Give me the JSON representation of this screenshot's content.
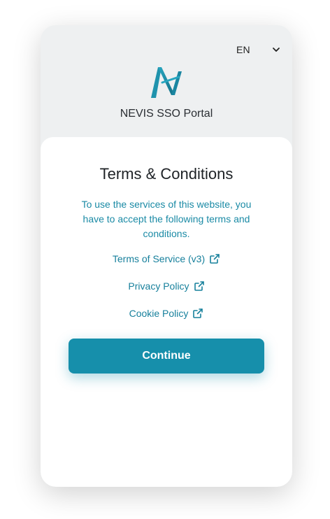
{
  "header": {
    "language": "EN",
    "portal_title": "NEVIS SSO Portal"
  },
  "terms": {
    "heading": "Terms & Conditions",
    "intro": "To use the services of this website, you have to accept the following terms and conditions.",
    "links": [
      {
        "label": "Terms of Service (v3)",
        "icon": "external-link-icon"
      },
      {
        "label": "Privacy Policy",
        "icon": "external-link-icon"
      },
      {
        "label": "Cookie Policy",
        "icon": "external-link-icon"
      }
    ],
    "continue_label": "Continue"
  },
  "colors": {
    "accent": "#168fab",
    "link": "#17809c",
    "card_bg": "#eef0f1",
    "panel_bg": "#ffffff"
  }
}
